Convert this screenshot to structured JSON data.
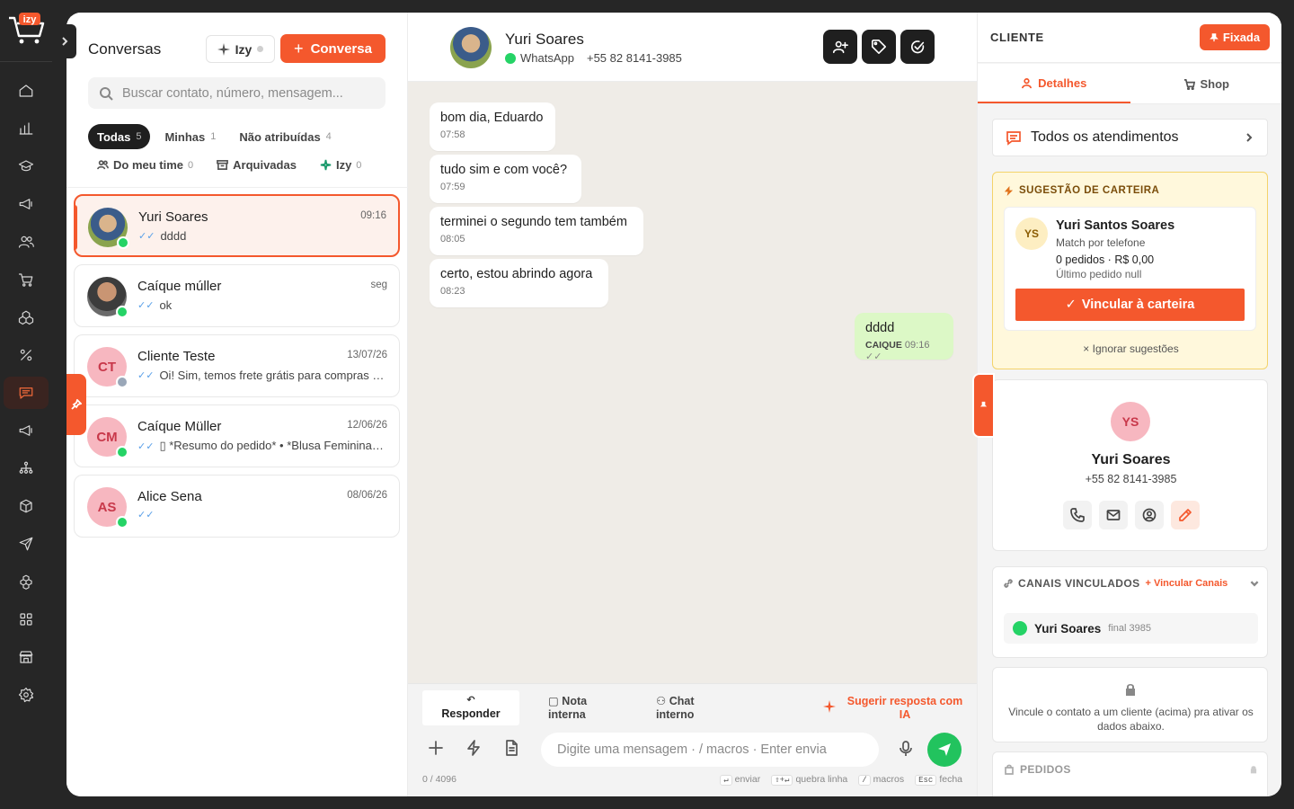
{
  "rail": {
    "logo_text": "izy",
    "nav": [
      "home-icon",
      "chart-icon",
      "graduation-icon",
      "megaphone-icon",
      "users-icon",
      "cart-icon",
      "boxes-icon",
      "percent-icon",
      "chat-icon",
      "megaphone-icon",
      "hierarchy-icon",
      "package-icon",
      "send-icon",
      "cubes-icon",
      "grid-icon",
      "store-icon",
      "settings-icon"
    ],
    "active_index": 8,
    "accent": "#f4582d"
  },
  "conversations": {
    "title": "Conversas",
    "izy_label": "Izy",
    "new_label": "Conversa",
    "search_placeholder": "Buscar contato, número, mensagem...",
    "filters": [
      {
        "label": "Todas",
        "count": "5",
        "active": true
      },
      {
        "label": "Minhas",
        "count": "1",
        "active": false
      },
      {
        "label": "Não atribuídas",
        "count": "4",
        "active": false
      }
    ],
    "filters2": [
      {
        "label": "Do meu time",
        "count": "0",
        "icon": "users-icon"
      },
      {
        "label": "Arquivadas",
        "count": "",
        "icon": "archive-icon"
      },
      {
        "label": "Izy",
        "count": "0",
        "icon": "sparkle-icon"
      }
    ],
    "items": [
      {
        "name": "Yuri Soares",
        "time": "09:16",
        "preview": "dddd",
        "avatar": "",
        "channel": "whatsapp",
        "active": true
      },
      {
        "name": "Caíque múller",
        "time": "seg",
        "preview": "ok",
        "avatar": "",
        "channel": "whatsapp",
        "active": false
      },
      {
        "name": "Cliente Teste",
        "time": "13/07/26",
        "preview": "Oi! Sim, temos frete grátis para compras a...",
        "avatar": "CT",
        "channel": "web",
        "active": false
      },
      {
        "name": "Caíque Müller",
        "time": "12/06/26",
        "preview": "▯ *Resumo do pedido* • *Blusa Feminina ...",
        "avatar": "CM",
        "channel": "whatsapp",
        "active": false
      },
      {
        "name": "Alice Sena",
        "time": "08/06/26",
        "preview": "",
        "avatar": "AS",
        "channel": "whatsapp",
        "active": false
      }
    ]
  },
  "chat": {
    "contact_name": "Yuri Soares",
    "channel": "WhatsApp",
    "phone": "+55 82 8141-3985",
    "messages": [
      {
        "text": "bom dia, Eduardo",
        "time": "07:58",
        "dir": "in"
      },
      {
        "text": "tudo sim e com você?",
        "time": "07:59",
        "dir": "in"
      },
      {
        "text": "terminei o segundo tem também",
        "time": "08:05",
        "dir": "in"
      },
      {
        "text": "certo, estou abrindo agora",
        "time": "08:23",
        "dir": "in"
      },
      {
        "text": "dddd",
        "time": "09:16",
        "author": "CAIQUE",
        "dir": "out"
      }
    ],
    "composer": {
      "tabs": [
        "Responder",
        "Nota interna",
        "Chat interno"
      ],
      "suggest_label": "Sugerir resposta com IA",
      "placeholder": "Digite uma mensagem · / macros · Enter envia",
      "counter": "0 / 4096",
      "shortcuts": [
        {
          "key": "↵",
          "label": "enviar"
        },
        {
          "key": "⇧+↵",
          "label": "quebra linha"
        },
        {
          "key": "/",
          "label": "macros"
        },
        {
          "key": "Esc",
          "label": "fecha"
        }
      ]
    }
  },
  "client": {
    "label": "CLIENTE",
    "pin_label": "Fixada",
    "tabs": [
      "Detalhes",
      "Shop"
    ],
    "all_label": "Todos os atendimentos",
    "suggestion": {
      "title": "SUGESTÃO DE CARTEIRA",
      "initials": "YS",
      "name": "Yuri Santos Soares",
      "match": "Match por telefone",
      "orders": "0 pedidos · R$ 0,00",
      "last": "Último pedido null",
      "link_label": "Vincular à carteira",
      "ignore_label": "Ignorar sugestões"
    },
    "profile": {
      "initials": "YS",
      "name": "Yuri Soares",
      "phone": "+55 82 8141-3985"
    },
    "channels": {
      "title": "CANAIS VINCULADOS",
      "link_label": "Vincular Canais",
      "name": "Yuri Soares",
      "final": "final 3985"
    },
    "locked_text": "Vincule o contato a um cliente (acima) pra ativar os dados abaixo.",
    "orders_title": "PEDIDOS"
  }
}
